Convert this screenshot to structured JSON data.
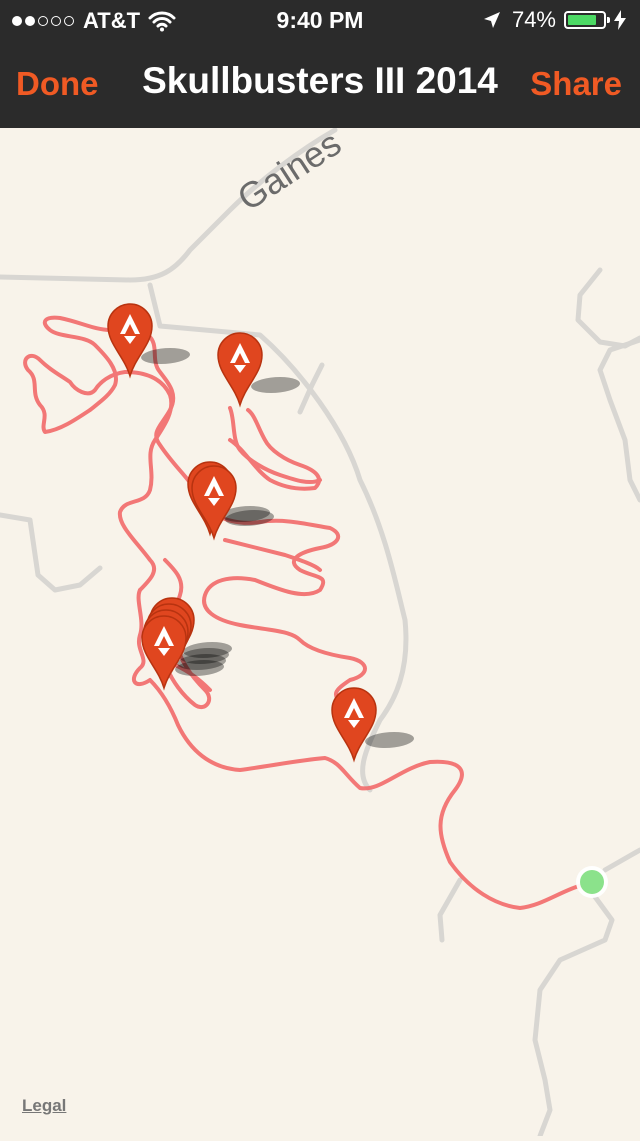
{
  "status_bar": {
    "carrier": "AT&T",
    "signal_bars_filled": 2,
    "signal_bars_total": 5,
    "time": "9:40 PM",
    "battery_percent_text": "74%",
    "battery_level": 0.74,
    "icons": [
      "wifi-icon",
      "location-arrow-icon",
      "battery-icon",
      "charging-bolt-icon"
    ]
  },
  "nav": {
    "done_label": "Done",
    "title": "Skullbusters III 2014",
    "share_label": "Share",
    "accent_color": "#f05a24",
    "bar_color": "#2b2b2b"
  },
  "map": {
    "road_label": "Gaines",
    "legal_label": "Legal",
    "route_color": "#f26a6a",
    "pin_color": "#e0461f",
    "end_marker_color": "#8be28b",
    "background_color": "#f8f3ea",
    "pin_count": 9
  }
}
